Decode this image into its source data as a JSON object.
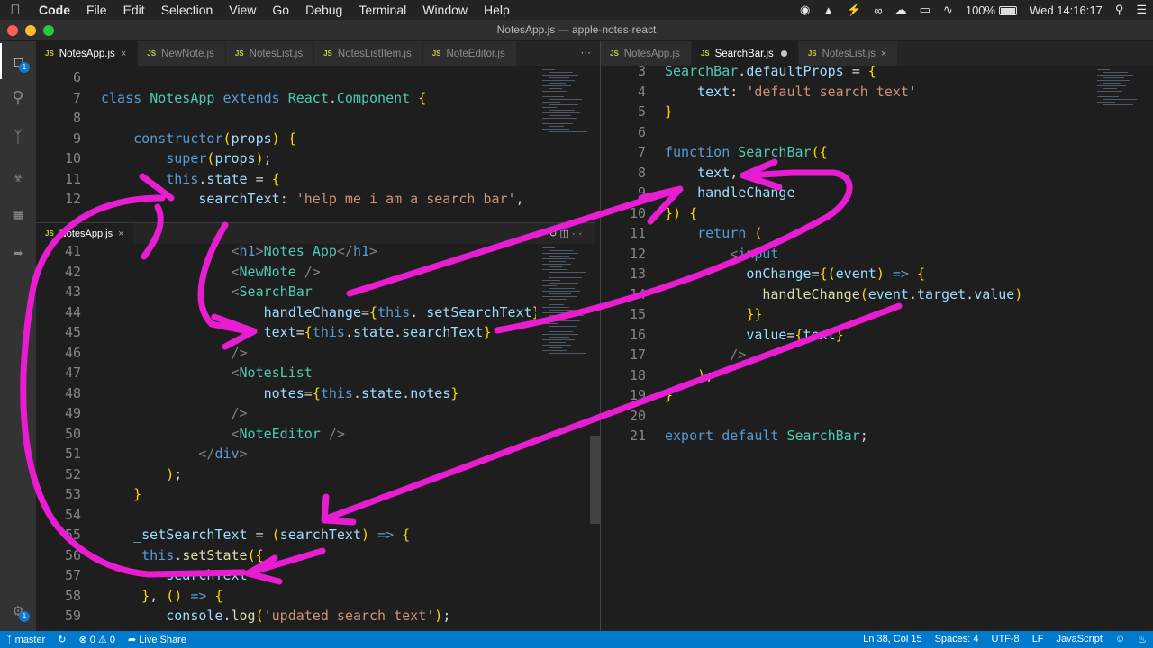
{
  "menubar": {
    "app": "Code",
    "items": [
      "File",
      "Edit",
      "Selection",
      "View",
      "Go",
      "Debug",
      "Terminal",
      "Window",
      "Help"
    ],
    "battery": "100%",
    "clock": "Wed 14:16:17"
  },
  "window": {
    "title": "NotesApp.js — apple-notes-react"
  },
  "left_tabs": [
    {
      "label": "NotesApp.js",
      "icon": "JS",
      "close": "×"
    },
    {
      "label": "NewNote.js",
      "icon": "JS"
    },
    {
      "label": "NotesList.js",
      "icon": "JS"
    },
    {
      "label": "NotesListItem.js",
      "icon": "JS"
    },
    {
      "label": "NoteEditor.js",
      "icon": "JS"
    }
  ],
  "right_tabs": [
    {
      "label": "NotesApp.js",
      "icon": "JS"
    },
    {
      "label": "SearchBar.js",
      "icon": "JS"
    },
    {
      "label": "NotesList.js",
      "icon": "JS",
      "close": "×"
    }
  ],
  "more_label": "···",
  "peek_tab": {
    "label": "NotesApp.js",
    "icon": "JS",
    "close": "×"
  },
  "activity_badge": "1",
  "settings_badge": "1",
  "status": {
    "branch": "master",
    "errors": "0",
    "warnings": "0",
    "live_share": "Live Share",
    "position": "Ln 38, Col 15",
    "spaces": "Spaces: 4",
    "encoding": "UTF-8",
    "eol": "LF",
    "language": "JavaScript"
  },
  "left_top_lines": [
    {
      "n": "6",
      "t": ""
    },
    {
      "n": "7",
      "t": "class NotesApp extends React.Component {"
    },
    {
      "n": "8",
      "t": ""
    },
    {
      "n": "9",
      "t": "    constructor(props) {"
    },
    {
      "n": "10",
      "t": "        super(props);"
    },
    {
      "n": "11",
      "t": "        this.state = {"
    },
    {
      "n": "12",
      "t": "            searchText: 'help me i am a search bar',"
    }
  ],
  "left_bottom_lines": [
    {
      "n": "41",
      "t": "                <h1>Notes App</h1>"
    },
    {
      "n": "42",
      "t": "                <NewNote />"
    },
    {
      "n": "43",
      "t": "                <SearchBar"
    },
    {
      "n": "44",
      "t": "                    handleChange={this._setSearchText}"
    },
    {
      "n": "45",
      "t": "                    text={this.state.searchText}"
    },
    {
      "n": "46",
      "t": "                />"
    },
    {
      "n": "47",
      "t": "                <NotesList"
    },
    {
      "n": "48",
      "t": "                    notes={this.state.notes}"
    },
    {
      "n": "49",
      "t": "                />"
    },
    {
      "n": "50",
      "t": "                <NoteEditor />"
    },
    {
      "n": "51",
      "t": "            </div>"
    },
    {
      "n": "52",
      "t": "        );"
    },
    {
      "n": "53",
      "t": "    }"
    },
    {
      "n": "54",
      "t": ""
    },
    {
      "n": "55",
      "t": "    _setSearchText = (searchText) => {"
    },
    {
      "n": "56",
      "t": "     this.setState({"
    },
    {
      "n": "57",
      "t": "        searchText"
    },
    {
      "n": "58",
      "t": "     }, () => {"
    },
    {
      "n": "59",
      "t": "        console.log('updated search text');"
    }
  ],
  "right_lines": [
    {
      "n": "3",
      "t": "SearchBar.defaultProps = {"
    },
    {
      "n": "4",
      "t": "    text: 'default search text'"
    },
    {
      "n": "5",
      "t": "}"
    },
    {
      "n": "6",
      "t": ""
    },
    {
      "n": "7",
      "t": "function SearchBar({"
    },
    {
      "n": "8",
      "t": "    text,"
    },
    {
      "n": "9",
      "t": "    handleChange"
    },
    {
      "n": "10",
      "t": "}) {"
    },
    {
      "n": "11",
      "t": "    return ("
    },
    {
      "n": "12",
      "t": "        <input"
    },
    {
      "n": "13",
      "t": "          onChange={(event) => {"
    },
    {
      "n": "14",
      "t": "            handleChange(event.target.value)"
    },
    {
      "n": "15",
      "t": "          }}"
    },
    {
      "n": "16",
      "t": "          value={text}"
    },
    {
      "n": "17",
      "t": "        />"
    },
    {
      "n": "18",
      "t": "    );"
    },
    {
      "n": "19",
      "t": "}"
    },
    {
      "n": "20",
      "t": ""
    },
    {
      "n": "21",
      "t": "export default SearchBar;"
    }
  ],
  "colors": {
    "accent": "#007acc",
    "annotation": "#e81cd0"
  }
}
